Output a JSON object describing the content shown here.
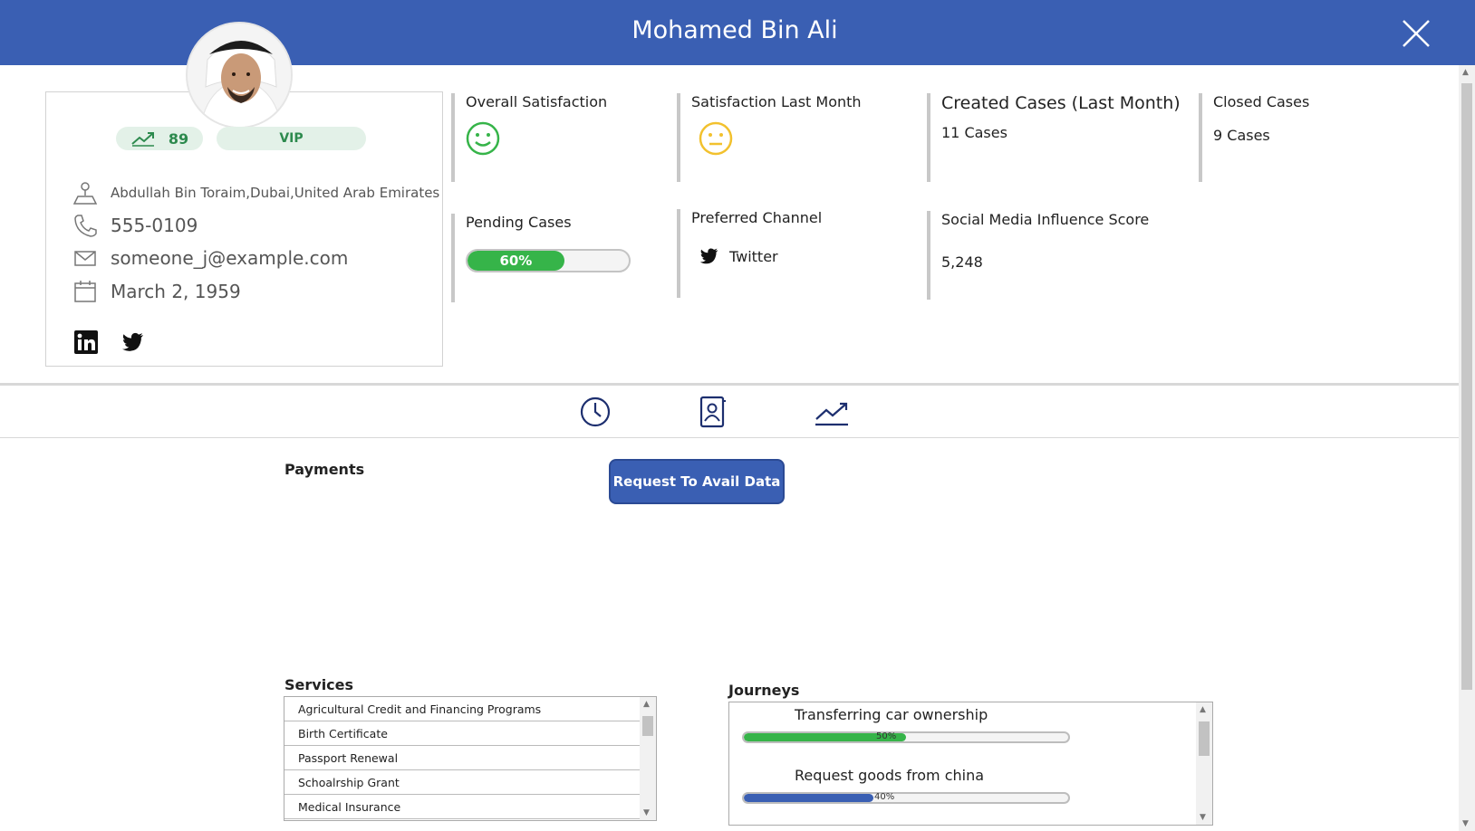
{
  "header": {
    "title": "Mohamed Bin Ali"
  },
  "profile": {
    "score": "89",
    "tier": "VIP",
    "address": "Abdullah Bin Toraim,Dubai,United Arab Emirates",
    "phone": "555-0109",
    "email": "someone_j@example.com",
    "birthdate": "March 2, 1959",
    "social": [
      "linkedin-icon",
      "twitter-icon"
    ]
  },
  "kpis": {
    "overall_satisfaction": {
      "label": "Overall Satisfaction",
      "icon": "smiley-happy-icon",
      "color": "#36b449"
    },
    "satisfaction_last_month": {
      "label": "Satisfaction Last Month",
      "icon": "smiley-neutral-icon",
      "color": "#f2c12e"
    },
    "created_cases": {
      "label": "Created Cases (Last Month)",
      "value": "11 Cases"
    },
    "closed_cases": {
      "label": "Closed Cases",
      "value": "9 Cases"
    },
    "pending_cases": {
      "label": "Pending Cases",
      "value": "60%",
      "fraction": 0.6
    },
    "preferred_channel": {
      "label": "Preferred Channel",
      "value": "Twitter",
      "icon": "twitter-icon"
    },
    "social_influence": {
      "label": "Social Media Influence Score",
      "value": "5,248"
    }
  },
  "tabs": [
    "clock-icon",
    "contact-book-icon",
    "trend-icon"
  ],
  "payments": {
    "title": "Payments",
    "button": "Request To Avail Data"
  },
  "services": {
    "title": "Services",
    "items": [
      "Agricultural Credit and Financing Programs",
      "Birth Certificate",
      "Passport Renewal",
      "Schoalrship Grant",
      "Medical Insurance"
    ]
  },
  "journeys": {
    "title": "Journeys",
    "items": [
      {
        "name": "Transferring car ownership",
        "pct_label": "50%",
        "fraction": 0.5,
        "color": "#36b449"
      },
      {
        "name": "Request goods from china",
        "pct_label": "40%",
        "fraction": 0.4,
        "color": "#3a5fb3"
      }
    ]
  },
  "colors": {
    "header": "#3a5fb3",
    "accent_green": "#36b449",
    "neutral_yellow": "#f2c12e"
  }
}
